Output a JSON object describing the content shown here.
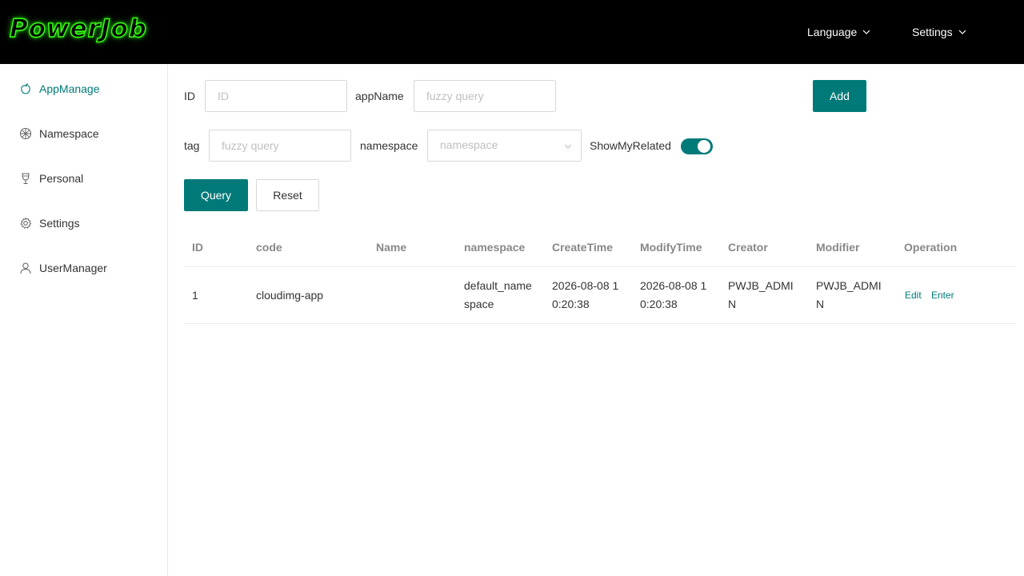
{
  "app": {
    "logo_text": "PowerJob",
    "accent": "#007a78",
    "logo_glow": "#39ff14"
  },
  "header": {
    "language": "Language",
    "settings": "Settings"
  },
  "sidebar": {
    "items": [
      {
        "label": "AppManage",
        "icon": "apple-icon",
        "active": true
      },
      {
        "label": "Namespace",
        "icon": "aperture-icon"
      },
      {
        "label": "Personal",
        "icon": "goblet-icon"
      },
      {
        "label": "Settings",
        "icon": "gear-icon"
      },
      {
        "label": "UserManager",
        "icon": "user-icon"
      }
    ]
  },
  "filters": {
    "id_label": "ID",
    "id_placeholder": "ID",
    "appname_label": "appName",
    "appname_placeholder": "fuzzy query",
    "tag_label": "tag",
    "tag_placeholder": "fuzzy query",
    "namespace_label": "namespace",
    "namespace_placeholder": "namespace",
    "show_related_label": "ShowMyRelated",
    "show_related_on": true
  },
  "buttons": {
    "add": "Add",
    "query": "Query",
    "reset": "Reset"
  },
  "table": {
    "columns": [
      "ID",
      "code",
      "Name",
      "namespace",
      "CreateTime",
      "ModifyTime",
      "Creator",
      "Modifier",
      "Operation"
    ],
    "rows": [
      {
        "id": "1",
        "code": "cloudimg-app",
        "name": "",
        "namespace": [
          "default_name",
          "space"
        ],
        "create_time": [
          "2026-08-08 1",
          "0:20:38"
        ],
        "modify_time": [
          "2026-08-08 1",
          "0:20:38"
        ],
        "creator": [
          "PWJB_ADMI",
          "N"
        ],
        "modifier": [
          "PWJB_ADMI",
          "N"
        ],
        "actions": [
          "Edit",
          "Enter"
        ]
      }
    ]
  }
}
